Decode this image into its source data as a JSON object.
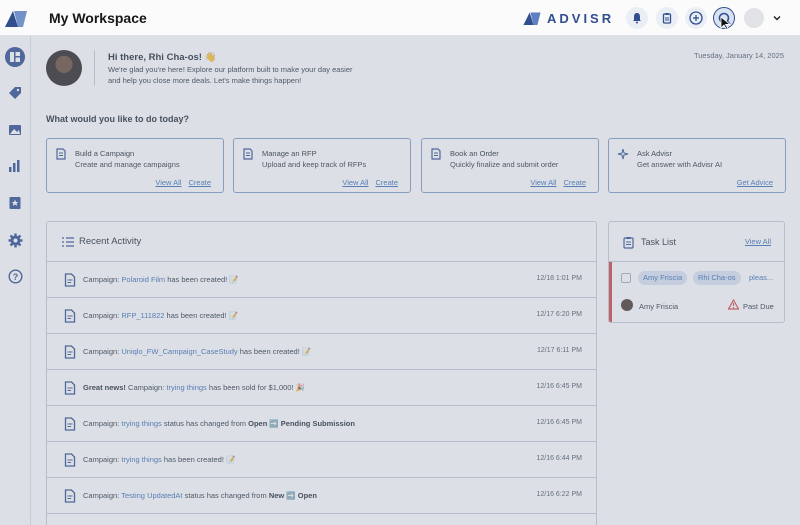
{
  "app": {
    "page_title": "My Workspace",
    "brand_name": "ADVISR",
    "accent_color": "#3b6db3",
    "top_icons": [
      "bell-icon",
      "clipboard-icon",
      "plus-circle-icon",
      "search-icon"
    ]
  },
  "sidebar": {
    "items": [
      "dashboard-icon",
      "tag-icon",
      "image-icon",
      "bar-chart-icon",
      "badge-icon",
      "gear-icon",
      "help-icon"
    ]
  },
  "welcome": {
    "greeting": "Hi there, Rhi Cha-os! 👋",
    "message_line1": "We're glad you're here! Explore our platform built to make your day easier",
    "message_line2": "and help you close more deals. Let's make things happen!",
    "date": "Tuesday, January 14, 2025"
  },
  "quick_actions": {
    "heading": "What would you like to do today?",
    "cards": [
      {
        "title": "Build a Campaign",
        "subtitle": "Create and manage campaigns",
        "link1": "View All",
        "link2": "Create"
      },
      {
        "title": "Manage an RFP",
        "subtitle": "Upload and keep track of RFPs",
        "link1": "View All",
        "link2": "Create"
      },
      {
        "title": "Book an Order",
        "subtitle": "Quickly finalize and submit order",
        "link1": "View All",
        "link2": "Create"
      },
      {
        "title": "Ask Advisr",
        "subtitle": "Get answer with Advisr AI",
        "link1": "Get Advice",
        "link2": ""
      }
    ]
  },
  "recent_activity": {
    "title": "Recent Activity",
    "rows": [
      {
        "prefix": "Campaign: ",
        "highlight": "Polaroid Film",
        "mid": " has been created! 📝",
        "bold1": "",
        "mid2": "",
        "bold2": "",
        "time": "12/18 1:01 PM"
      },
      {
        "prefix": "Campaign: ",
        "highlight": "RFP_111822",
        "mid": " has been created! 📝",
        "bold1": "",
        "mid2": "",
        "bold2": "",
        "time": "12/17 6:20 PM"
      },
      {
        "prefix": "Campaign: ",
        "highlight": "Uniqlo_FW_Campaign_CaseStudy",
        "mid": " has been created! 📝",
        "bold1": "",
        "mid2": "",
        "bold2": "",
        "time": "12/17 6:11 PM"
      },
      {
        "prefix_bold": "Great news!",
        "prefix": " Campaign: ",
        "highlight": "trying things",
        "mid": " has been sold for $1,000! 🎉",
        "bold1": "",
        "mid2": "",
        "bold2": "",
        "time": "12/16 6:45 PM"
      },
      {
        "prefix": "Campaign: ",
        "highlight": "trying things",
        "mid": " status has changed from ",
        "bold1": "Open",
        "mid2": " ➡️ ",
        "bold2": "Pending Submission",
        "time": "12/16 6:45 PM"
      },
      {
        "prefix": "Campaign: ",
        "highlight": "trying things",
        "mid": " has been created! 📝",
        "bold1": "",
        "mid2": "",
        "bold2": "",
        "time": "12/16 6:44 PM"
      },
      {
        "prefix": "Campaign: ",
        "highlight": "Testing UpdatedAt",
        "mid": " status has changed from ",
        "bold1": "New",
        "mid2": " ➡️ ",
        "bold2": "Open",
        "time": "12/16 6:22 PM"
      }
    ]
  },
  "task_list": {
    "title": "Task List",
    "view_all": "View All",
    "task": {
      "chip1": "Amy Friscia",
      "chip2": "Rhi Cha-os",
      "more": "pleas...",
      "assignee": "Amy Friscia",
      "status": "Past Due",
      "status_color": "#d64545"
    }
  }
}
